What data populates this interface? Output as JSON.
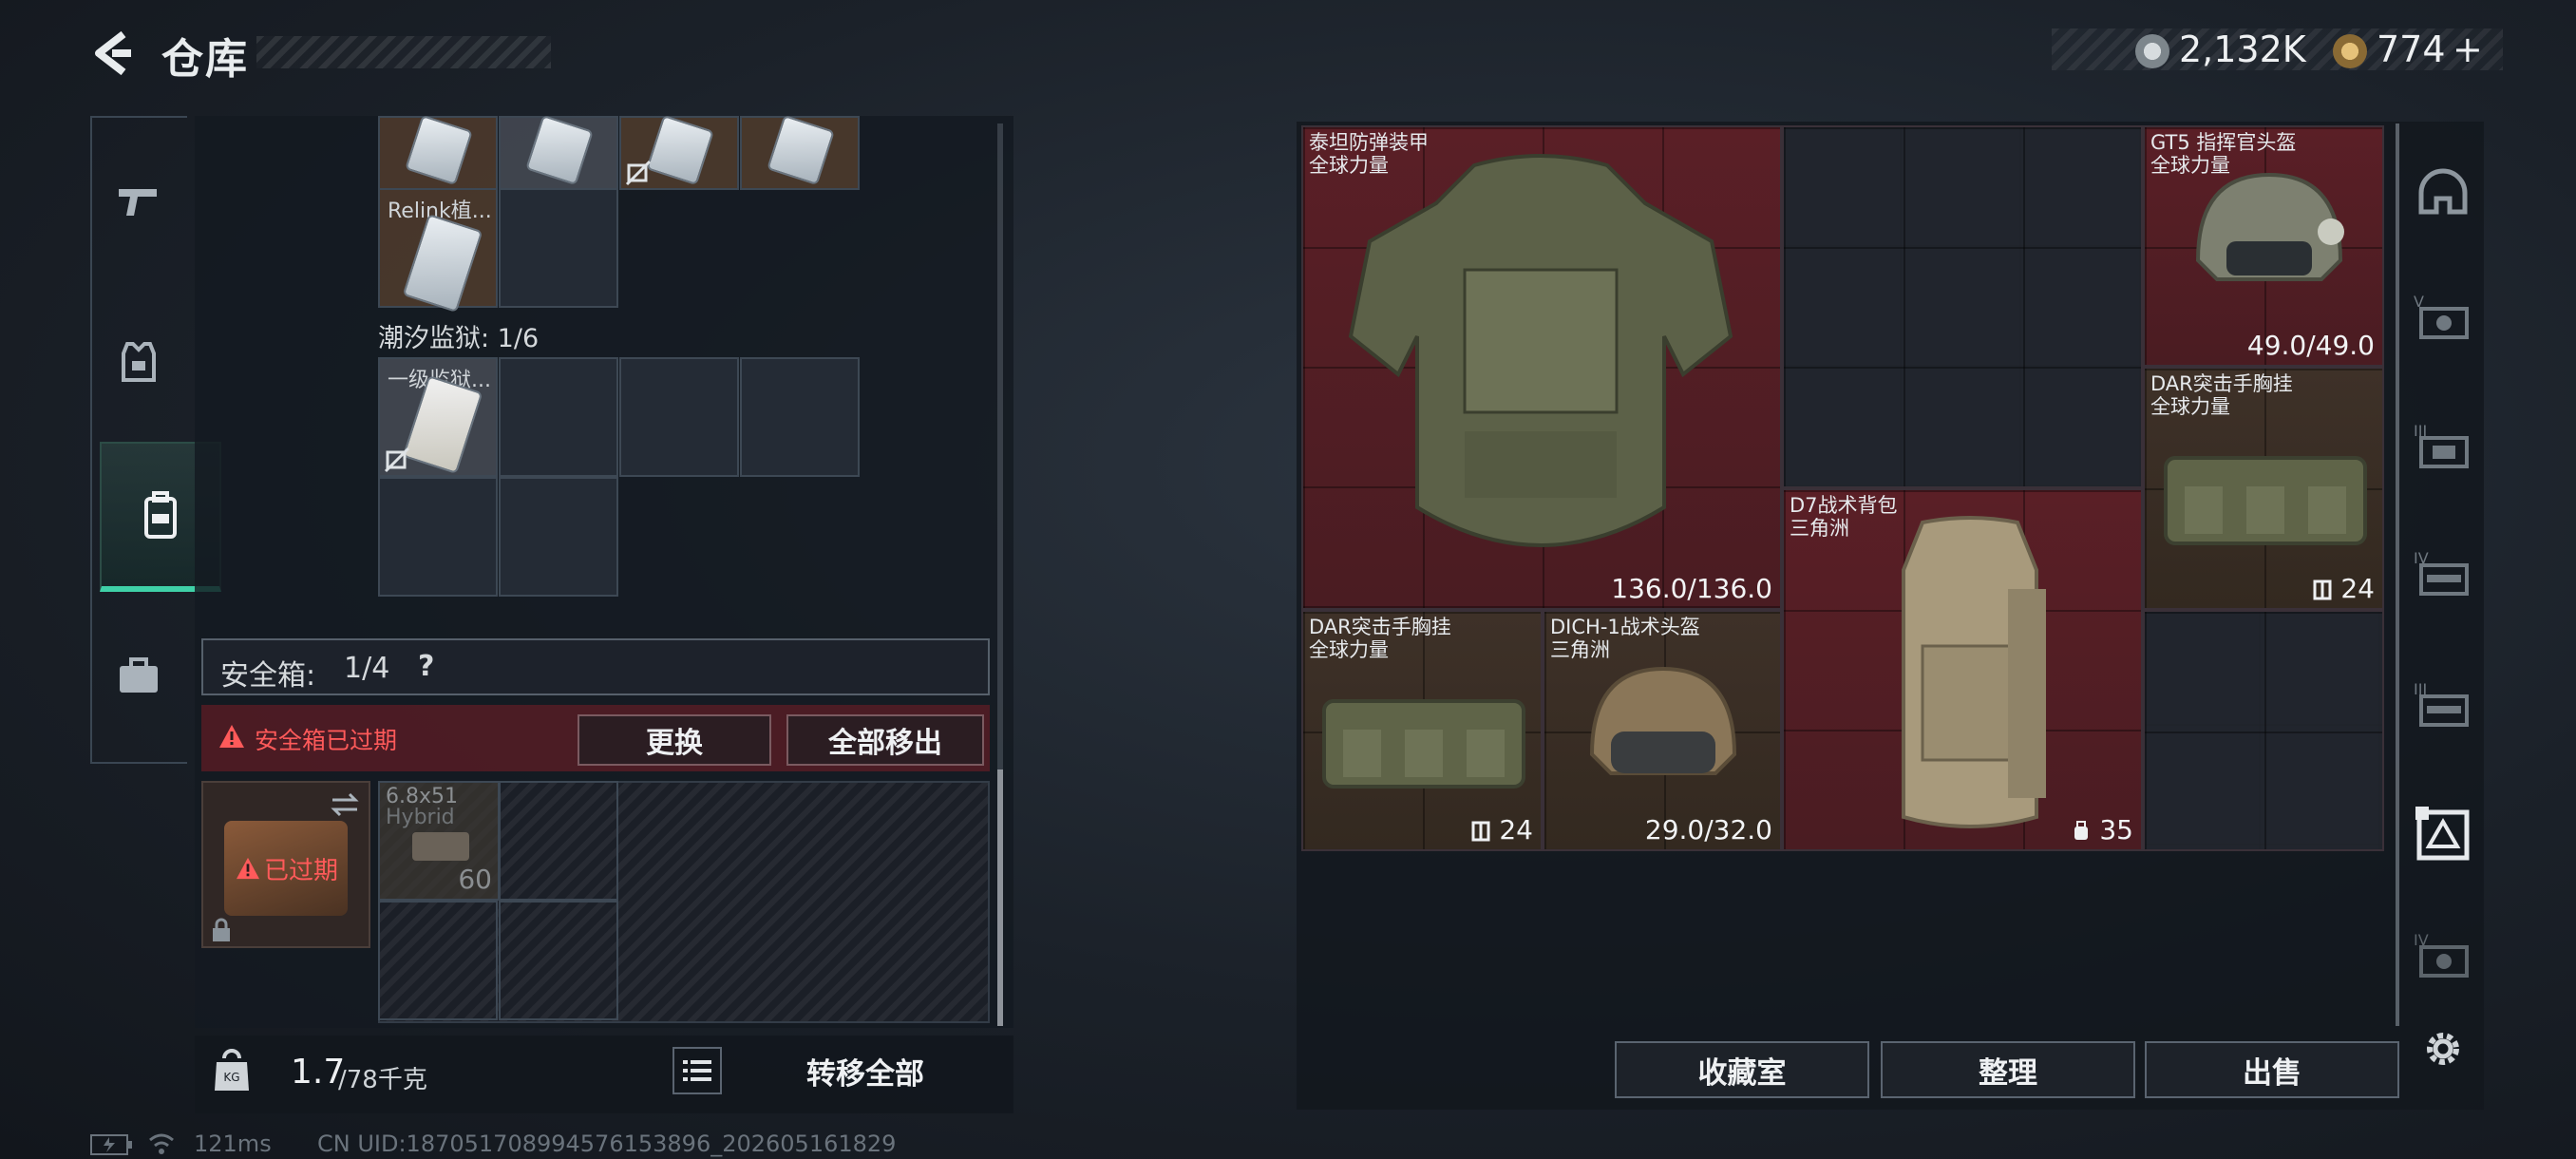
{
  "header": {
    "title": "仓库",
    "currency_1": "2,132K",
    "currency_2": "774",
    "currency_2_add": "+"
  },
  "stash": {
    "top_item_label": "Relink植...",
    "section_label": "潮汐监狱: 1/6",
    "prison_item_label": "一级监狱...",
    "safe_box_label": "安全箱:",
    "safe_box_count": "1/4",
    "safe_box_help": "?",
    "expired_label": "安全箱已过期",
    "replace_button": "更换",
    "move_all_out_button": "全部移出",
    "expired_badge": "已过期",
    "ammo_name_1": "6.8x51",
    "ammo_name_2": "Hybrid",
    "ammo_count": "60",
    "weight_current": "1.7",
    "weight_max": "/78千克",
    "transfer_all_button": "转移全部"
  },
  "equipment": {
    "armor": {
      "name": "泰坦防弹装甲",
      "sub": "全球力量",
      "value": "136.0/136.0"
    },
    "helmet_gt5": {
      "name": "GT5 指挥官头盔",
      "sub": "全球力量",
      "value": "49.0/49.0"
    },
    "chest_rig_top": {
      "name": "DAR突击手胸挂",
      "sub": "全球力量",
      "value": "24"
    },
    "backpack": {
      "name": "D7战术背包",
      "sub": "三角洲",
      "value": "35"
    },
    "chest_rig_bottom": {
      "name": "DAR突击手胸挂",
      "sub": "全球力量",
      "value": "24"
    },
    "helmet_dich": {
      "name": "DICH-1战术头盔",
      "sub": "三角洲",
      "value": "29.0/32.0"
    }
  },
  "actions": {
    "collection_button": "收藏室",
    "sort_button": "整理",
    "sell_button": "出售"
  },
  "status": {
    "ping": "121ms",
    "uid": "CN UID:1870517089945761538​96_202605161829"
  },
  "colors": {
    "accent": "#3fd1a8",
    "danger": "#ff5a5a",
    "slot_red": "#5a1f26",
    "slot_brown": "#3e3128"
  }
}
